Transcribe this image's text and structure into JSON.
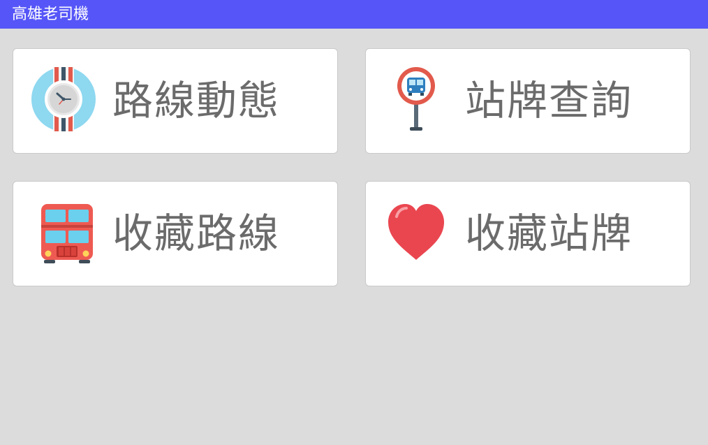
{
  "app": {
    "title": "高雄老司機",
    "header_color": "#5656f8"
  },
  "menu": [
    {
      "label": "路線動態",
      "icon": "watch-icon"
    },
    {
      "label": "站牌查詢",
      "icon": "bus-stop-sign-icon"
    },
    {
      "label": "收藏路線",
      "icon": "double-decker-bus-icon"
    },
    {
      "label": "收藏站牌",
      "icon": "heart-icon"
    }
  ]
}
